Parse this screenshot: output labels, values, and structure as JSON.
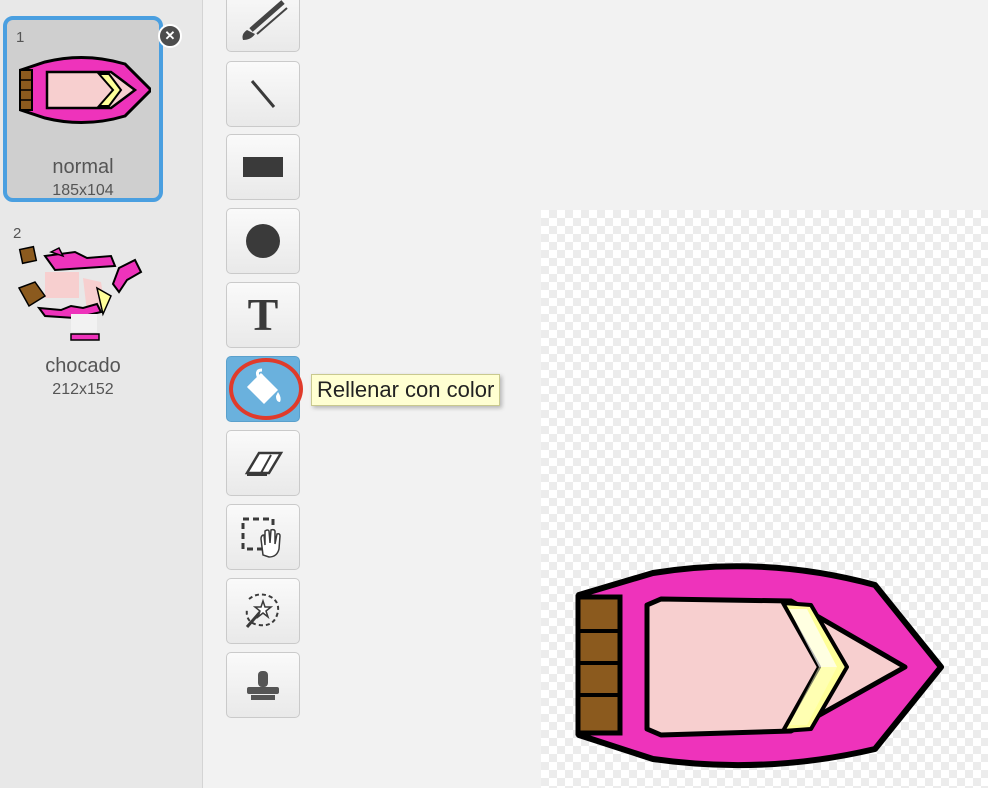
{
  "costumes": [
    {
      "number": "1",
      "name": "normal",
      "size": "185x104",
      "selected": true
    },
    {
      "number": "2",
      "name": "chocado",
      "size": "212x152",
      "selected": false
    }
  ],
  "delete_icon": "close-icon",
  "toolbar": {
    "tools": [
      {
        "name": "brush",
        "icon": "brush-icon"
      },
      {
        "name": "line",
        "icon": "line-icon"
      },
      {
        "name": "rectangle",
        "icon": "rectangle-icon"
      },
      {
        "name": "ellipse",
        "icon": "ellipse-icon"
      },
      {
        "name": "text",
        "icon": "text-icon",
        "glyph": "T"
      },
      {
        "name": "fill",
        "icon": "paint-bucket-icon",
        "active": true
      },
      {
        "name": "eraser",
        "icon": "eraser-icon"
      },
      {
        "name": "select",
        "icon": "select-hand-icon"
      },
      {
        "name": "select-remove-background",
        "icon": "magic-wand-icon"
      },
      {
        "name": "stamp",
        "icon": "stamp-icon"
      }
    ],
    "tooltip": "Rellenar con color"
  },
  "colors": {
    "selection_border": "#4a9fe0",
    "active_tool": "#6ab1dd",
    "highlight_circle": "#e03b2b",
    "tooltip_bg": "#ffffd2",
    "boat_hull": "#ee33bb",
    "boat_deck": "#f7cfcf",
    "boat_windshield": "#ffff99",
    "boat_stern": "#8b5a1e"
  }
}
